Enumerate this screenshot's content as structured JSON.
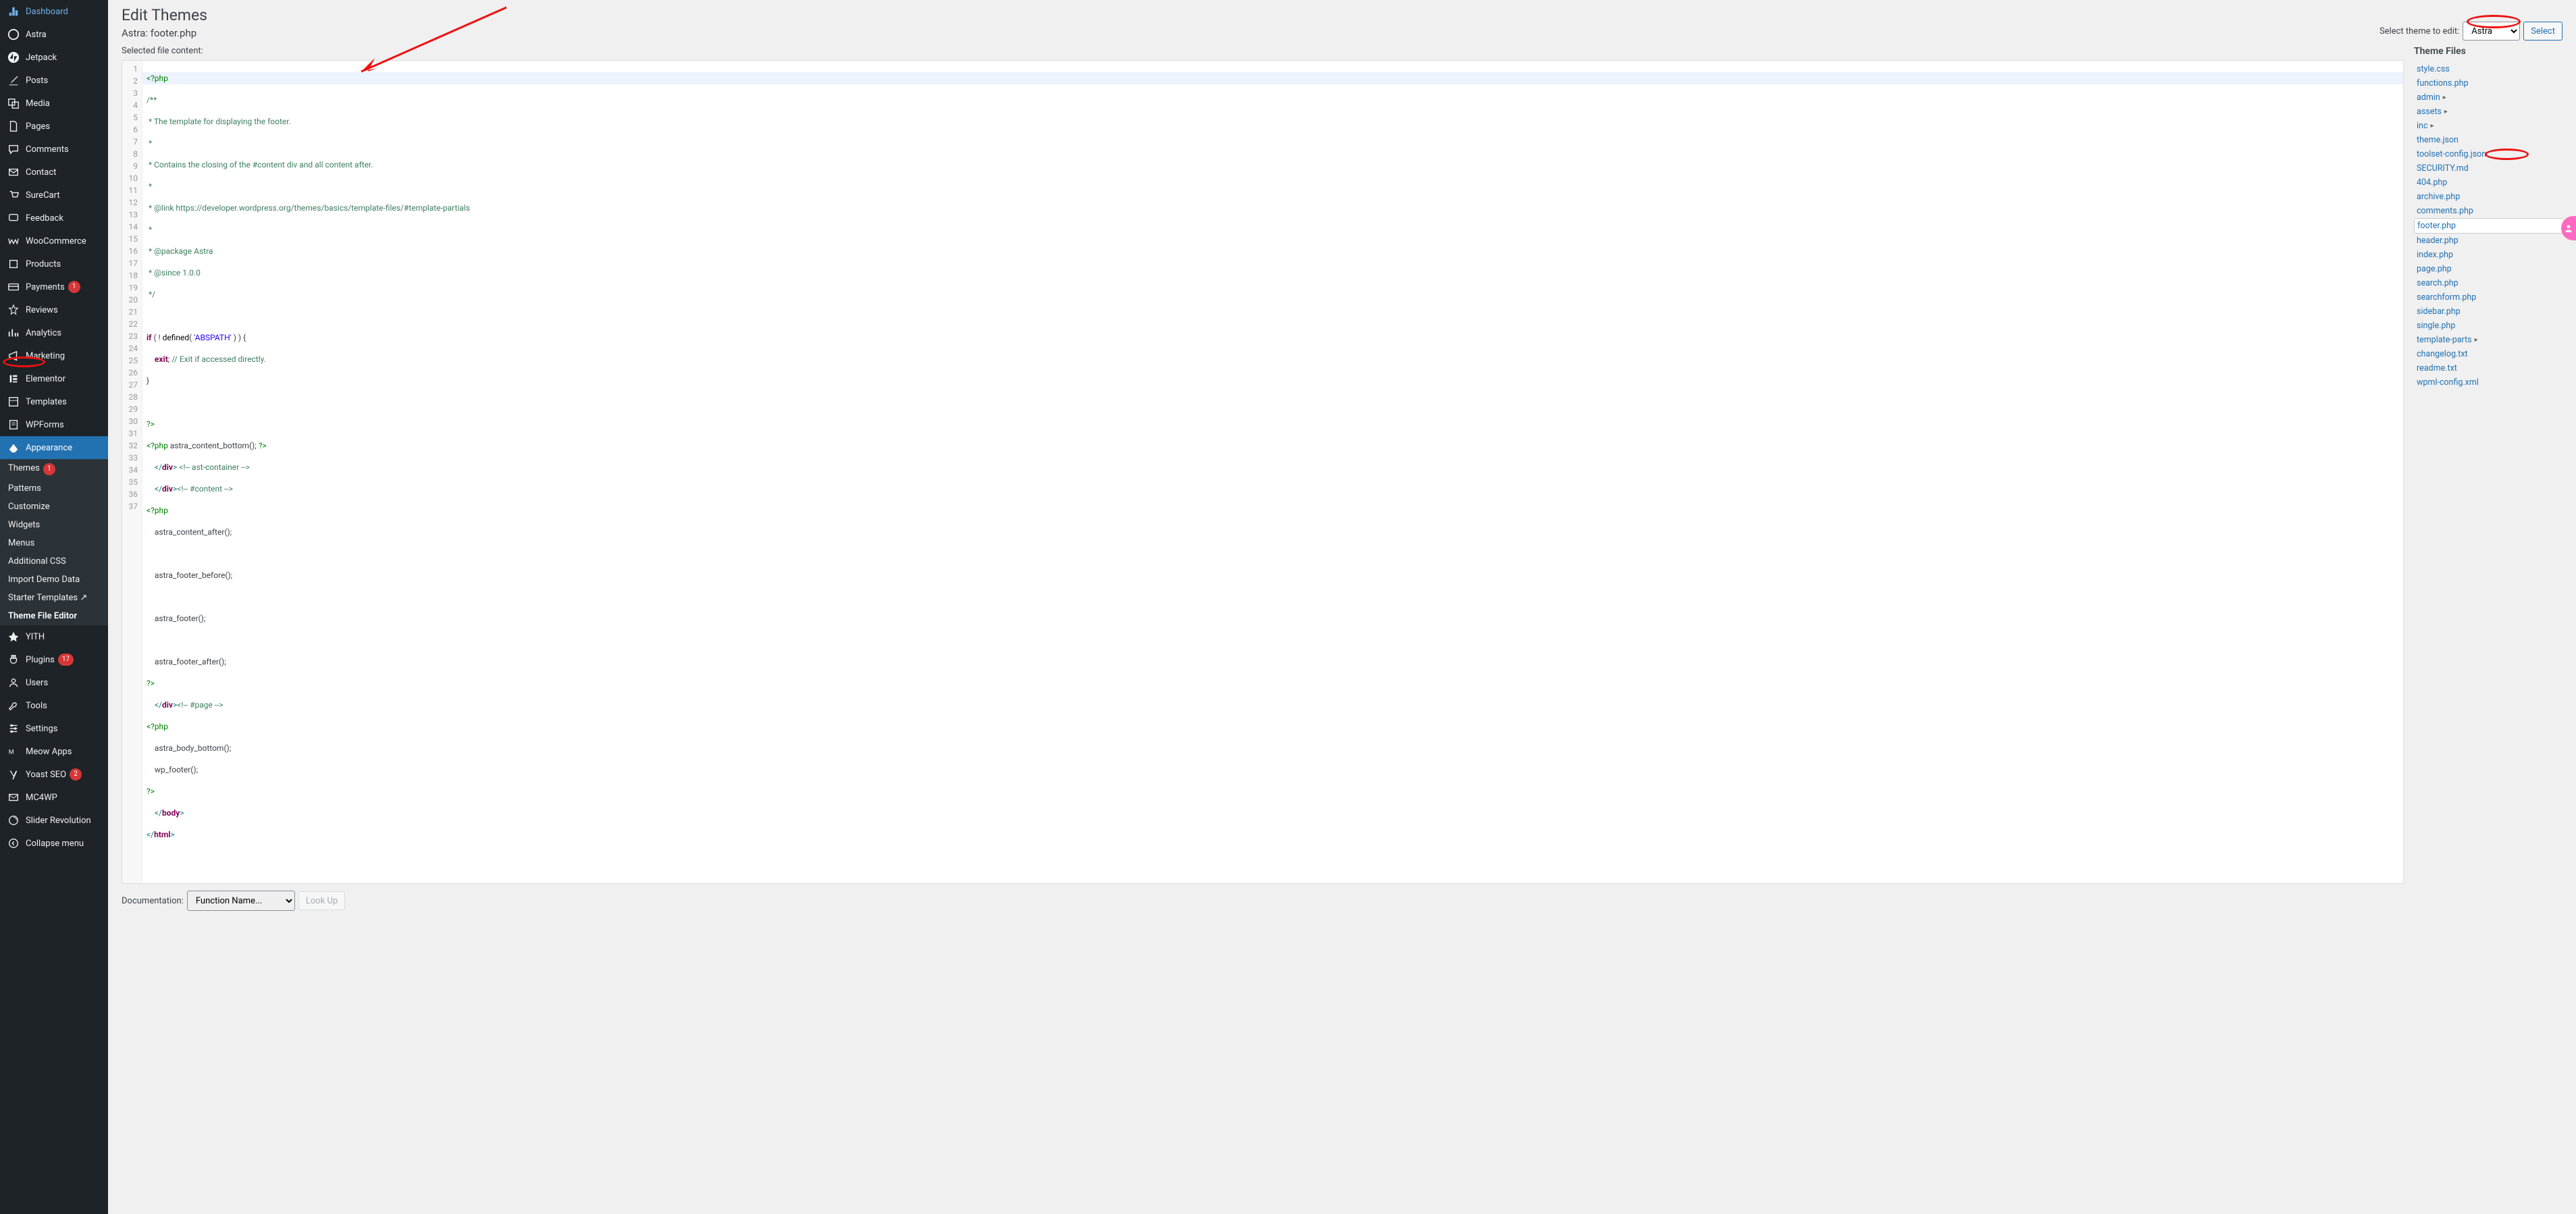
{
  "sidebar": {
    "items": [
      {
        "label": "Dashboard",
        "icon": "dashboard"
      },
      {
        "label": "Astra",
        "icon": "astra"
      },
      {
        "label": "Jetpack",
        "icon": "jetpack"
      },
      {
        "label": "Posts",
        "icon": "posts"
      },
      {
        "label": "Media",
        "icon": "media"
      },
      {
        "label": "Pages",
        "icon": "pages"
      },
      {
        "label": "Comments",
        "icon": "comments"
      },
      {
        "label": "Contact",
        "icon": "contact"
      },
      {
        "label": "SureCart",
        "icon": "surecart"
      },
      {
        "label": "Feedback",
        "icon": "feedback"
      },
      {
        "label": "WooCommerce",
        "icon": "woo"
      },
      {
        "label": "Products",
        "icon": "products"
      },
      {
        "label": "Payments",
        "icon": "payments",
        "badge": "1"
      },
      {
        "label": "Reviews",
        "icon": "reviews"
      },
      {
        "label": "Analytics",
        "icon": "analytics"
      },
      {
        "label": "Marketing",
        "icon": "marketing"
      },
      {
        "label": "Elementor",
        "icon": "elementor"
      },
      {
        "label": "Templates",
        "icon": "templates"
      },
      {
        "label": "WPForms",
        "icon": "wpforms"
      },
      {
        "label": "Appearance",
        "icon": "appearance",
        "active": true
      }
    ],
    "submenu": [
      {
        "label": "Themes",
        "badge": "1"
      },
      {
        "label": "Patterns"
      },
      {
        "label": "Customize"
      },
      {
        "label": "Widgets"
      },
      {
        "label": "Menus"
      },
      {
        "label": "Additional CSS"
      },
      {
        "label": "Import Demo Data"
      },
      {
        "label": "Starter Templates",
        "ext": true
      },
      {
        "label": "Theme File Editor",
        "active": true
      }
    ],
    "items2": [
      {
        "label": "YITH",
        "icon": "yith"
      },
      {
        "label": "Plugins",
        "icon": "plugins",
        "badge": "17"
      },
      {
        "label": "Users",
        "icon": "users"
      },
      {
        "label": "Tools",
        "icon": "tools"
      },
      {
        "label": "Settings",
        "icon": "settings"
      },
      {
        "label": "Meow Apps",
        "icon": "meow"
      },
      {
        "label": "Yoast SEO",
        "icon": "yoast",
        "badge": "2"
      },
      {
        "label": "MC4WP",
        "icon": "mc4wp"
      },
      {
        "label": "Slider Revolution",
        "icon": "slider"
      },
      {
        "label": "Collapse menu",
        "icon": "collapse"
      }
    ]
  },
  "page": {
    "title": "Edit Themes",
    "subtitle": "Astra: footer.php",
    "selected_label": "Selected file content:",
    "select_theme_label": "Select theme to edit:",
    "theme_selected": "Astra",
    "select_btn": "Select",
    "docs_label": "Documentation:",
    "docs_placeholder": "Function Name...",
    "lookup_btn": "Look Up"
  },
  "files": {
    "heading": "Theme Files",
    "list": [
      {
        "name": "style.css"
      },
      {
        "name": "functions.php"
      },
      {
        "name": "admin",
        "folder": true
      },
      {
        "name": "assets",
        "folder": true
      },
      {
        "name": "inc",
        "folder": true
      },
      {
        "name": "theme.json"
      },
      {
        "name": "toolset-config.json"
      },
      {
        "name": "SECURITY.md"
      },
      {
        "name": "404.php"
      },
      {
        "name": "archive.php"
      },
      {
        "name": "comments.php"
      },
      {
        "name": "footer.php",
        "selected": true
      },
      {
        "name": "header.php"
      },
      {
        "name": "index.php"
      },
      {
        "name": "page.php"
      },
      {
        "name": "search.php"
      },
      {
        "name": "searchform.php"
      },
      {
        "name": "sidebar.php"
      },
      {
        "name": "single.php"
      },
      {
        "name": "template-parts",
        "folder": true
      },
      {
        "name": "changelog.txt"
      },
      {
        "name": "readme.txt"
      },
      {
        "name": "wpml-config.xml"
      }
    ]
  },
  "code": {
    "line1": "<?php",
    "line2": "/**",
    "line3": " * The template for displaying the footer.",
    "line4": " *",
    "line5": " * Contains the closing of the #content div and all content after.",
    "line6": " *",
    "line7": " * @link https://developer.wordpress.org/themes/basics/template-files/#template-partials",
    "line8": " *",
    "line9": " * @package Astra",
    "line10": " * @since 1.0.0",
    "line11": " */",
    "line13a": "if",
    "line13b": " ( ! ",
    "line13c": "defined",
    "line13d": "( ",
    "line13e": "'ABSPATH'",
    "line13f": " ) ) {",
    "line14a": "    exit",
    "line14b": "; ",
    "line14c": "// Exit if accessed directly.",
    "line15": "}",
    "line17": "?>",
    "line18a": "<?php",
    "line18b": " astra_content_bottom(); ",
    "line18c": "?>",
    "line19a": "    </",
    "line19b": "div",
    "line19c": "> ",
    "line19d": "<!-- ast-container -->",
    "line20a": "    </",
    "line20b": "div",
    "line20c": ">",
    "line20d": "<!-- #content -->",
    "line21": "<?php",
    "line22": "    astra_content_after();",
    "line24": "    astra_footer_before();",
    "line26": "    astra_footer();",
    "line28": "    astra_footer_after();",
    "line29": "?>",
    "line30a": "    </",
    "line30b": "div",
    "line30c": ">",
    "line30d": "<!-- #page -->",
    "line31": "<?php",
    "line32": "    astra_body_bottom();",
    "line33": "    wp_footer();",
    "line34": "?>",
    "line35a": "    </",
    "line35b": "body",
    "line35c": ">",
    "line36a": "</",
    "line36b": "html",
    "line36c": ">"
  }
}
